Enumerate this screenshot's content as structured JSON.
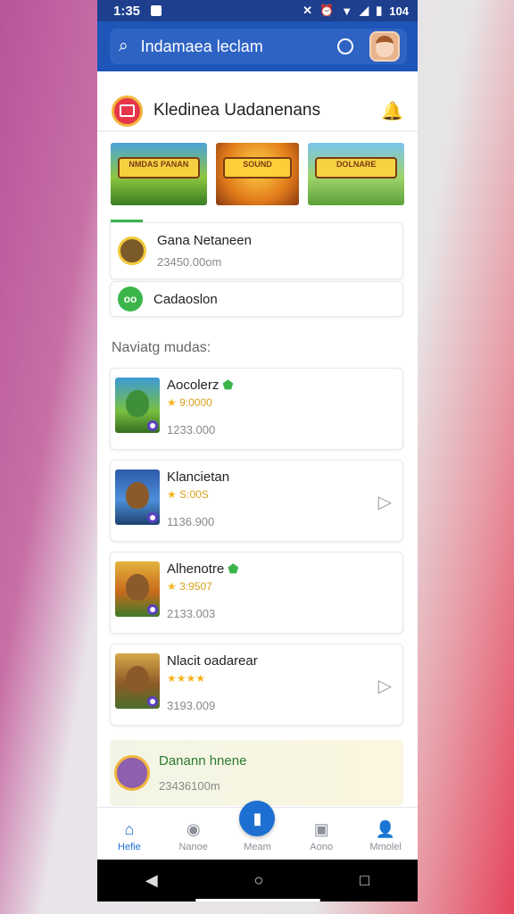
{
  "status_bar": {
    "time": "1:35",
    "battery_text": "104"
  },
  "search": {
    "placeholder": "Indamaea leclam"
  },
  "header": {
    "title": "Kledinea Uadanenans"
  },
  "banners": [
    {
      "label": "NMDAS PANAN"
    },
    {
      "label": "SOUND"
    },
    {
      "label": "DOLNARE"
    }
  ],
  "summary": [
    {
      "title": "Gana Netaneen",
      "subtitle": "23450.00om"
    },
    {
      "title": "Cadaoslon",
      "subtitle": ""
    }
  ],
  "section_label": "Naviatg mudas:",
  "games": [
    {
      "title": "Aocolerz",
      "rating": "9:0000",
      "count": "1233.000"
    },
    {
      "title": "Klancietan",
      "rating": "S:00S",
      "count": "1136.900"
    },
    {
      "title": "Alhenotre",
      "rating": "3:9507",
      "count": "2133.003"
    },
    {
      "title": "Nlacit oadarear",
      "rating": "",
      "count": "3193.009"
    }
  ],
  "promo": {
    "title": "Danann hnene",
    "subtitle": "23436100m"
  },
  "bottom_nav": [
    {
      "label": "Hefie",
      "active": true
    },
    {
      "label": "Nanoe"
    },
    {
      "label": "Meam"
    },
    {
      "label": "Aono"
    },
    {
      "label": "Mmolel"
    }
  ],
  "colors": {
    "accent": "#1d55b8",
    "brand_green": "#3bb54a",
    "star": "#f2b51c"
  },
  "icons": {
    "search": "search-icon",
    "bell": "bell-icon",
    "play": "play-icon"
  }
}
